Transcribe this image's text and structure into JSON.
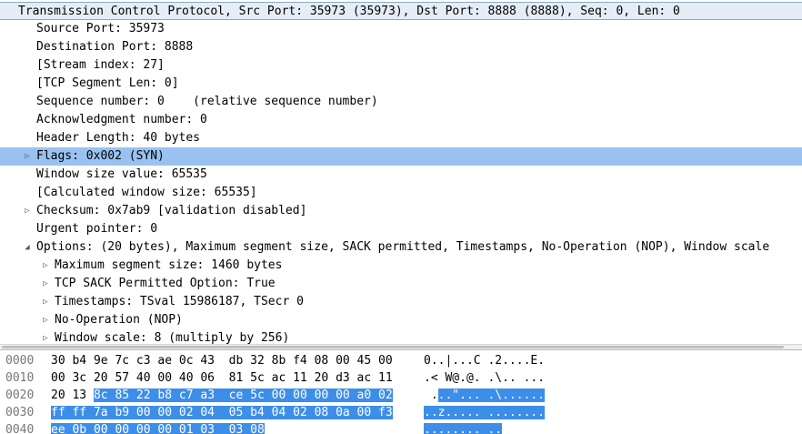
{
  "tree": [
    {
      "text": "Transmission Control Protocol, Src Port: 35973 (35973), Dst Port: 8888 (8888), Seq: 0, Len: 0",
      "indent": 0,
      "arrow": "",
      "state": "header"
    },
    {
      "text": "Source Port: 35973",
      "indent": 1,
      "arrow": "",
      "state": ""
    },
    {
      "text": "Destination Port: 8888",
      "indent": 1,
      "arrow": "",
      "state": ""
    },
    {
      "text": "[Stream index: 27]",
      "indent": 1,
      "arrow": "",
      "state": ""
    },
    {
      "text": "[TCP Segment Len: 0]",
      "indent": 1,
      "arrow": "",
      "state": ""
    },
    {
      "text": "Sequence number: 0    (relative sequence number)",
      "indent": 1,
      "arrow": "",
      "state": ""
    },
    {
      "text": "Acknowledgment number: 0",
      "indent": 1,
      "arrow": "",
      "state": ""
    },
    {
      "text": "Header Length: 40 bytes",
      "indent": 1,
      "arrow": "",
      "state": ""
    },
    {
      "text": "Flags: 0x002 (SYN)",
      "indent": 1,
      "arrow": "collapsed",
      "state": "selected"
    },
    {
      "text": "Window size value: 65535",
      "indent": 1,
      "arrow": "",
      "state": ""
    },
    {
      "text": "[Calculated window size: 65535]",
      "indent": 1,
      "arrow": "",
      "state": ""
    },
    {
      "text": "Checksum: 0x7ab9 [validation disabled]",
      "indent": 1,
      "arrow": "collapsed",
      "state": ""
    },
    {
      "text": "Urgent pointer: 0",
      "indent": 1,
      "arrow": "",
      "state": ""
    },
    {
      "text": "Options: (20 bytes), Maximum segment size, SACK permitted, Timestamps, No-Operation (NOP), Window scale",
      "indent": 1,
      "arrow": "expanded",
      "state": ""
    },
    {
      "text": "Maximum segment size: 1460 bytes",
      "indent": 2,
      "arrow": "collapsed",
      "state": ""
    },
    {
      "text": "TCP SACK Permitted Option: True",
      "indent": 2,
      "arrow": "collapsed",
      "state": ""
    },
    {
      "text": "Timestamps: TSval 15986187, TSecr 0",
      "indent": 2,
      "arrow": "collapsed",
      "state": ""
    },
    {
      "text": "No-Operation (NOP)",
      "indent": 2,
      "arrow": "collapsed",
      "state": ""
    },
    {
      "text": "Window scale: 8 (multiply by 256)",
      "indent": 2,
      "arrow": "collapsed",
      "state": ""
    }
  ],
  "hex": [
    {
      "offset": "0000",
      "bytes_plain": "30 b4 9e 7c c3 ae 0c 43  db 32 8b f4 08 00 45 00",
      "bytes_hl": "",
      "ascii_plain": "0..|...C .2....E.",
      "ascii_hl": ""
    },
    {
      "offset": "0010",
      "bytes_plain": "00 3c 20 57 40 00 40 06  81 5c ac 11 20 d3 ac 11",
      "bytes_hl": "",
      "ascii_plain": ".< W@.@. .\\.. ...",
      "ascii_hl": ""
    },
    {
      "offset": "0020",
      "bytes_plain": "20 13 ",
      "bytes_hl": "8c 85 22 b8 c7 a3  ce 5c 00 00 00 00 a0 02",
      "ascii_plain": " .",
      "ascii_hl": "..\"... .\\......"
    },
    {
      "offset": "0030",
      "bytes_plain": "",
      "bytes_hl": "ff ff 7a b9 00 00 02 04  05 b4 04 02 08 0a 00 f3",
      "ascii_plain": "",
      "ascii_hl": "..z..... ........"
    },
    {
      "offset": "0040",
      "bytes_plain": "",
      "bytes_hl": "ee 0b 00 00 00 00 01 03  03 08",
      "ascii_plain": "",
      "ascii_hl": "........ .."
    }
  ],
  "icons": {
    "collapsed": "▷",
    "expanded": "◢"
  },
  "colors": {
    "selected": "#99c2f0",
    "hex_highlight": "#3d8ee8",
    "header": "#e6edf7"
  }
}
